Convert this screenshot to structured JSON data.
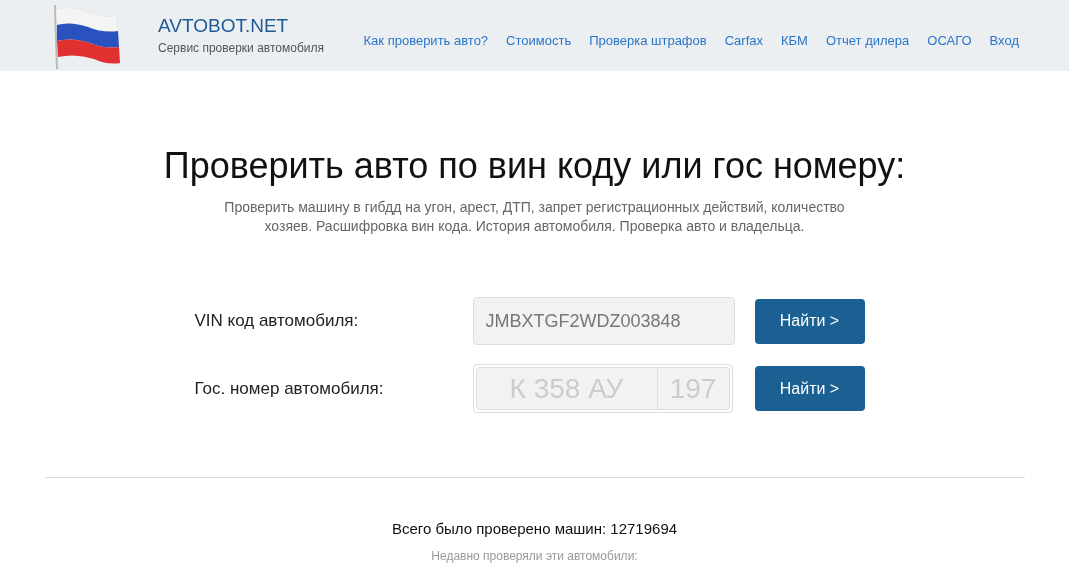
{
  "header": {
    "brand": "AVTOBOT.NET",
    "tagline": "Сервис проверки автомобиля",
    "nav": [
      "Как проверить авто?",
      "Стоимость",
      "Проверка штрафов",
      "Carfax",
      "КБМ",
      "Отчет дилера",
      "ОСАГО",
      "Вход"
    ]
  },
  "hero": {
    "title": "Проверить авто по вин коду или гос номеру:",
    "subtitle": "Проверить машину в гибдд на угон, арест, ДТП, запрет регистрационных действий, количество хозяев. Расшифровка вин кода. История автомобиля. Проверка авто и владельца."
  },
  "vin": {
    "label": "VIN код автомобиля:",
    "placeholder": "JMBXTGF2WDZ003848",
    "button": "Найти >"
  },
  "plate": {
    "label": "Гос. номер автомобиля:",
    "number_placeholder": "К 358 АУ",
    "region_placeholder": "197",
    "button": "Найти >"
  },
  "stats": {
    "total": "Всего было проверено машин: 12719694",
    "recent": "Недавно проверяли эти автомобили:"
  }
}
